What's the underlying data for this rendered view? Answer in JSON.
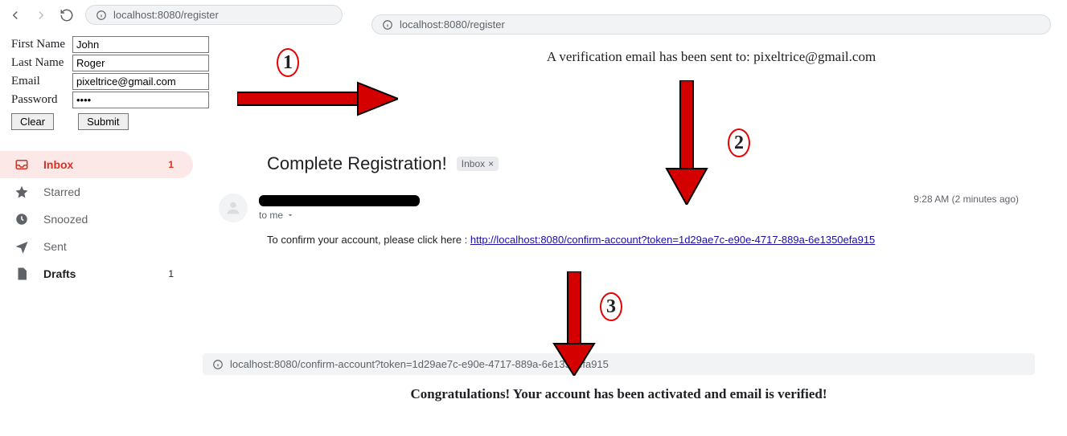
{
  "browser_left": {
    "url_text": "localhost:8080/register"
  },
  "form": {
    "labels": {
      "first_name": "First Name",
      "last_name": "Last Name",
      "email": "Email",
      "password": "Password"
    },
    "values": {
      "first_name": "John",
      "last_name": "Roger",
      "email": "pixeltrice@gmail.com",
      "password": "••••"
    },
    "clear": "Clear",
    "submit": "Submit"
  },
  "gmail": {
    "items": [
      {
        "label": "Inbox",
        "count": "1",
        "active": true,
        "icon": "inbox"
      },
      {
        "label": "Starred",
        "icon": "star"
      },
      {
        "label": "Snoozed",
        "icon": "clock"
      },
      {
        "label": "Sent",
        "icon": "send"
      },
      {
        "label": "Drafts",
        "count": "1",
        "icon": "file"
      }
    ]
  },
  "right": {
    "url_text": "localhost:8080/register",
    "verify": "A verification email has been sent to: pixeltrice@gmail.com",
    "subject": "Complete Registration!",
    "inbox_chip": "Inbox",
    "to_line": "to me",
    "timestamp": "9:28 AM (2 minutes ago)",
    "body_prefix": "To confirm your account, please click here : ",
    "link": "http://localhost:8080/confirm-account?token=1d29ae7c-e90e-4717-889a-6e1350efa915"
  },
  "bottom": {
    "url_text": "localhost:8080/confirm-account?token=1d29ae7c-e90e-4717-889a-6e1350efa915",
    "congrats": "Congratulations! Your account has been activated and email is verified!"
  },
  "annotations": {
    "n1": "1",
    "n2": "2",
    "n3": "3"
  }
}
